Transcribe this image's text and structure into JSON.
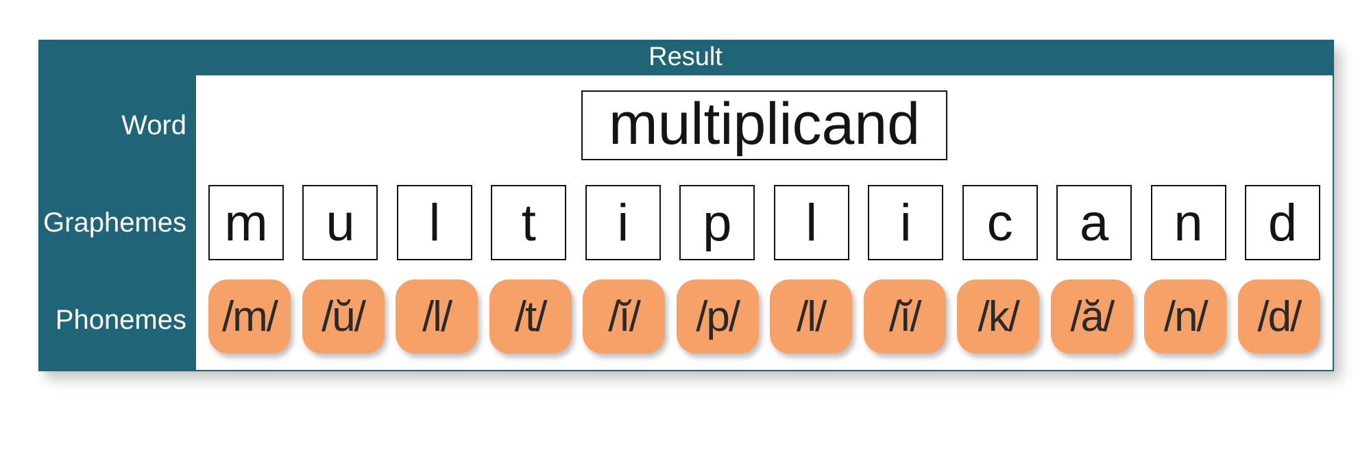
{
  "header": "Result",
  "rows": {
    "word_label": "Word",
    "graphemes_label": "Graphemes",
    "phonemes_label": "Phonemes"
  },
  "word": "multiplicand",
  "graphemes": [
    "m",
    "u",
    "l",
    "t",
    "i",
    "p",
    "l",
    "i",
    "c",
    "a",
    "n",
    "d"
  ],
  "phonemes": [
    "/m/",
    "/ŭ/",
    "/l/",
    "/t/",
    "/ĭ/",
    "/p/",
    "/l/",
    "/ĭ/",
    "/k/",
    "/ă/",
    "/n/",
    "/d/"
  ]
}
